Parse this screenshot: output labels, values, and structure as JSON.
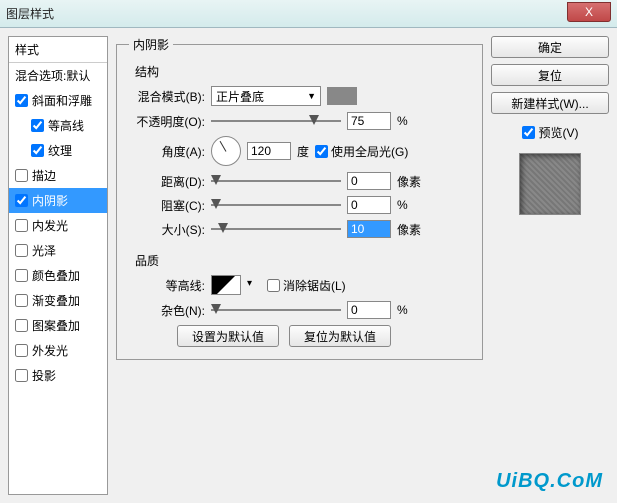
{
  "window": {
    "title": "图层样式",
    "close": "X"
  },
  "sidebar": {
    "header": "样式",
    "blend_defaults": "混合选项:默认",
    "items": [
      {
        "label": "斜面和浮雕",
        "checked": true,
        "indent": false
      },
      {
        "label": "等高线",
        "checked": true,
        "indent": true
      },
      {
        "label": "纹理",
        "checked": true,
        "indent": true
      },
      {
        "label": "描边",
        "checked": false,
        "indent": false
      },
      {
        "label": "内阴影",
        "checked": true,
        "indent": false,
        "selected": true
      },
      {
        "label": "内发光",
        "checked": false,
        "indent": false
      },
      {
        "label": "光泽",
        "checked": false,
        "indent": false
      },
      {
        "label": "颜色叠加",
        "checked": false,
        "indent": false
      },
      {
        "label": "渐变叠加",
        "checked": false,
        "indent": false
      },
      {
        "label": "图案叠加",
        "checked": false,
        "indent": false
      },
      {
        "label": "外发光",
        "checked": false,
        "indent": false
      },
      {
        "label": "投影",
        "checked": false,
        "indent": false
      }
    ]
  },
  "panel": {
    "title": "内阴影",
    "structure_title": "结构",
    "blend_mode_label": "混合模式(B):",
    "blend_mode_value": "正片叠底",
    "opacity_label": "不透明度(O):",
    "opacity_value": "75",
    "percent": "%",
    "angle_label": "角度(A):",
    "angle_value": "120",
    "degree": "度",
    "global_light_label": "使用全局光(G)",
    "distance_label": "距离(D):",
    "distance_value": "0",
    "px": "像素",
    "choke_label": "阻塞(C):",
    "choke_value": "0",
    "size_label": "大小(S):",
    "size_value": "10",
    "quality_title": "品质",
    "contour_label": "等高线:",
    "antialias_label": "消除锯齿(L)",
    "noise_label": "杂色(N):",
    "noise_value": "0",
    "reset_default": "设置为默认值",
    "revert_default": "复位为默认值"
  },
  "right": {
    "ok": "确定",
    "reset": "复位",
    "new_style": "新建样式(W)...",
    "preview_label": "预览(V)"
  },
  "watermark": "UiBQ.CoM"
}
